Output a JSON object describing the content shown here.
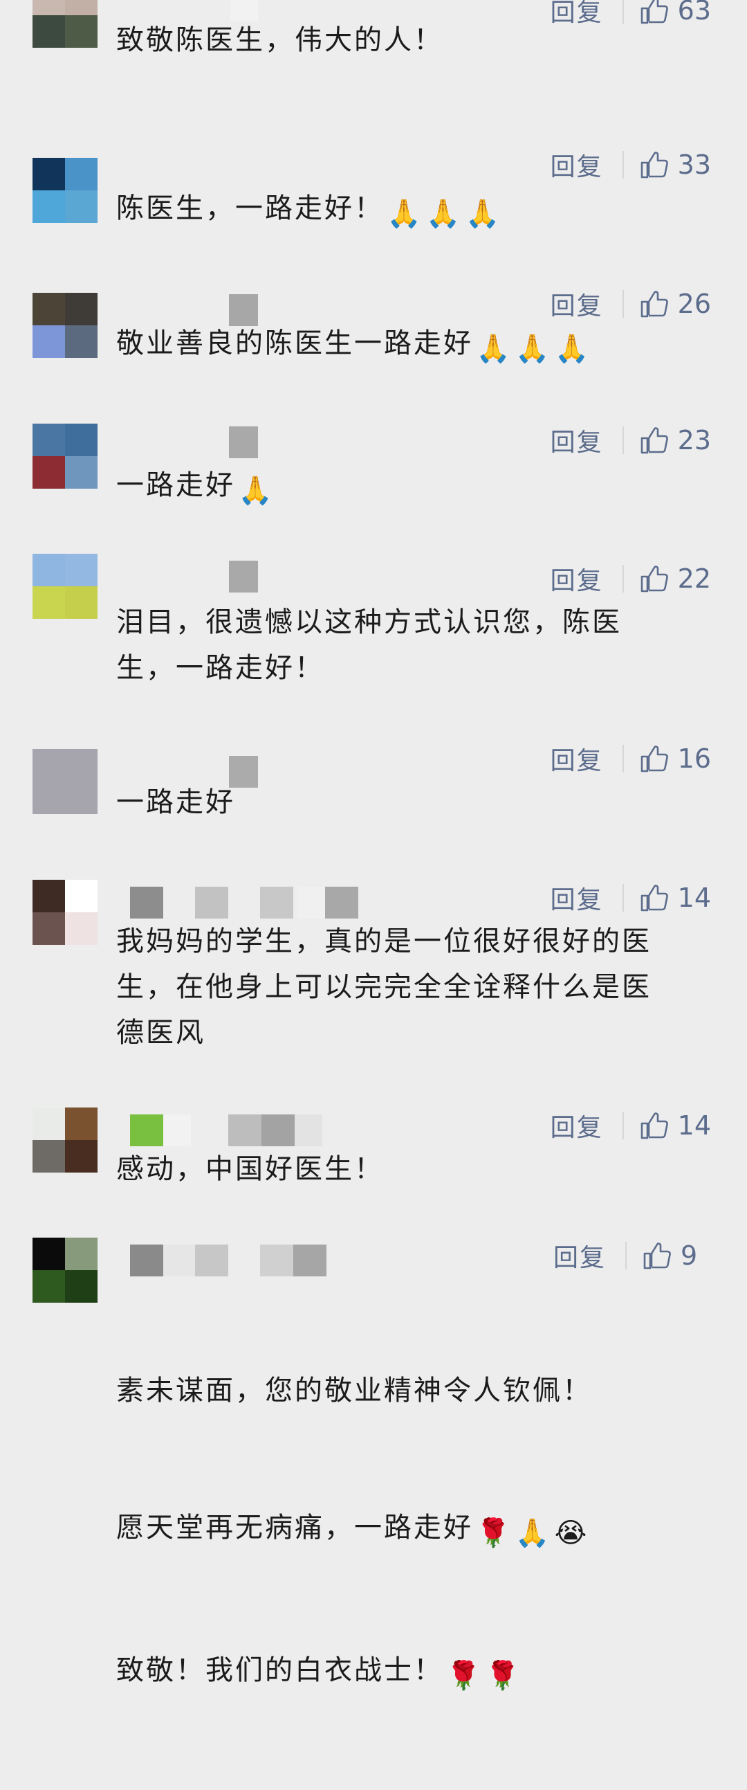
{
  "reply_label": "回复",
  "comments": [
    {
      "text": "致敬陈医生，伟大的人！",
      "likes": "63",
      "emojis": []
    },
    {
      "text": "陈医生，一路走好！",
      "likes": "33",
      "emojis": [
        "pray-icon",
        "pray-icon",
        "pray-icon"
      ]
    },
    {
      "text": "敬业善良的陈医生一路走好",
      "likes": "26",
      "emojis": [
        "pray-icon",
        "pray-icon",
        "pray-icon"
      ]
    },
    {
      "text": "一路走好",
      "likes": "23",
      "emojis": [
        "pray-icon"
      ]
    },
    {
      "text": "泪目，很遗憾以这种方式认识您，陈医\n生，一路走好！",
      "likes": "22",
      "emojis": []
    },
    {
      "text": "一路走好",
      "likes": "16",
      "emojis": []
    },
    {
      "text": "我妈妈的学生，真的是一位很好很好的医\n生，在他身上可以完完全全诠释什么是医\n德医风",
      "likes": "14",
      "emojis": []
    },
    {
      "text": "感动，中国好医生！",
      "likes": "14",
      "emojis": []
    },
    {
      "text_lines": [
        "素未谋面，您的敬业精神令人钦佩！",
        "愿天堂再无病痛，一路走好",
        "致敬！我们的白衣战士！"
      ],
      "likes": "9"
    }
  ]
}
